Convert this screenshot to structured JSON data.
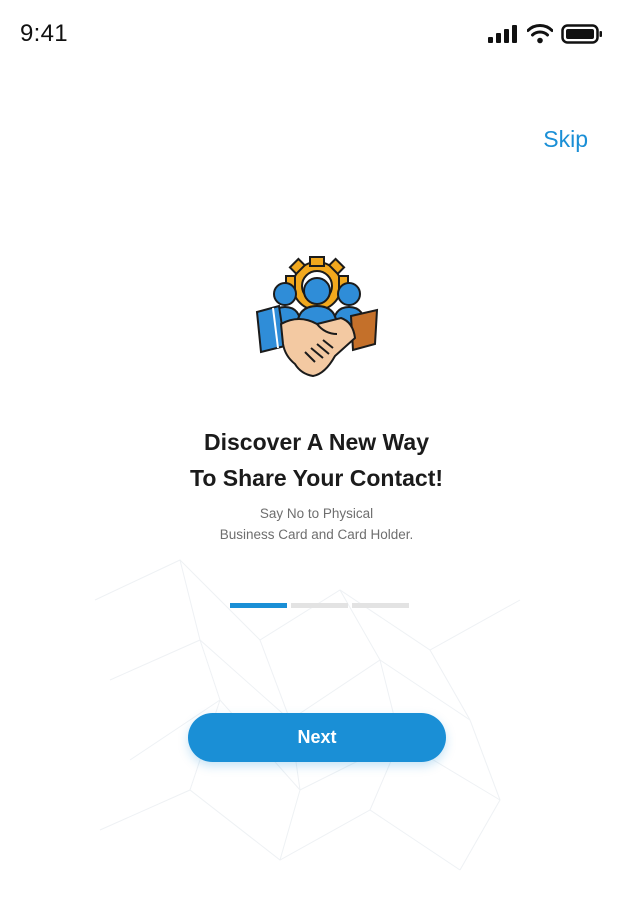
{
  "status_bar": {
    "time": "9:41",
    "icons": [
      "signal-icon",
      "wifi-icon",
      "battery-icon"
    ]
  },
  "onboarding": {
    "skip_label": "Skip",
    "hero_icon": "handshake-team-icon",
    "headline_line1": "Discover A New Way",
    "headline_line2": "To Share Your Contact!",
    "subtext_line1": "Say No to Physical",
    "subtext_line2": "Business Card and Card Holder.",
    "progress": {
      "current_step": 1,
      "total_steps": 3
    },
    "next_label": "Next"
  },
  "colors": {
    "accent": "#1a8fd6",
    "gear": "#f2a81d",
    "sleeve_right": "#c4702a",
    "skin": "#f3c9a2",
    "people": "#2f8dd8",
    "text_dark": "#1b1b1b",
    "text_muted": "#6e6e6e",
    "progress_inactive": "#e3e3e3"
  }
}
